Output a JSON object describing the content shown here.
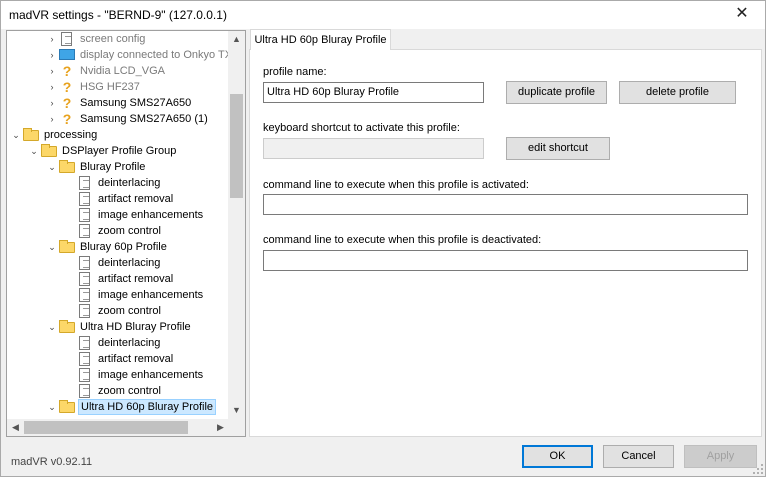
{
  "window": {
    "title": "madVR settings - \"BERND-9\" (127.0.0.1)",
    "close_glyph": "✕"
  },
  "tree": {
    "items": [
      {
        "label": "screen config",
        "icon": "doc-icon",
        "dim": true
      },
      {
        "label": "display connected to Onkyo TX-N",
        "icon": "monitor-icon",
        "dim": true
      },
      {
        "label": "Nvidia LCD_VGA",
        "icon": "question-icon",
        "dim": true
      },
      {
        "label": "HSG HF237",
        "icon": "question-icon",
        "dim": true
      },
      {
        "label": "Samsung SMS27A650",
        "icon": "question-icon",
        "dim": false
      },
      {
        "label": "Samsung SMS27A650 (1)",
        "icon": "question-icon",
        "dim": false
      },
      {
        "label": "processing",
        "icon": "folder-icon",
        "dim": false
      },
      {
        "label": "DSPlayer Profile Group",
        "icon": "folder-icon",
        "dim": false
      },
      {
        "label": "Bluray Profile",
        "icon": "folder-icon",
        "dim": false
      },
      {
        "label": "deinterlacing",
        "icon": "doc-icon",
        "dim": false
      },
      {
        "label": "artifact removal",
        "icon": "doc-icon",
        "dim": false
      },
      {
        "label": "image enhancements",
        "icon": "doc-icon",
        "dim": false
      },
      {
        "label": "zoom control",
        "icon": "doc-icon",
        "dim": false
      },
      {
        "label": "Bluray 60p Profile",
        "icon": "folder-icon",
        "dim": false
      },
      {
        "label": "deinterlacing",
        "icon": "doc-icon",
        "dim": false
      },
      {
        "label": "artifact removal",
        "icon": "doc-icon",
        "dim": false
      },
      {
        "label": "image enhancements",
        "icon": "doc-icon",
        "dim": false
      },
      {
        "label": "zoom control",
        "icon": "doc-icon",
        "dim": false
      },
      {
        "label": "Ultra HD Bluray Profile",
        "icon": "folder-icon",
        "dim": false
      },
      {
        "label": "deinterlacing",
        "icon": "doc-icon",
        "dim": false
      },
      {
        "label": "artifact removal",
        "icon": "doc-icon",
        "dim": false
      },
      {
        "label": "image enhancements",
        "icon": "doc-icon",
        "dim": false
      },
      {
        "label": "zoom control",
        "icon": "doc-icon",
        "dim": false
      },
      {
        "label": "Ultra HD 60p Bluray Profile",
        "icon": "folder-open-icon",
        "dim": false,
        "selected": true
      }
    ]
  },
  "tab": {
    "label": "Ultra HD 60p Bluray Profile"
  },
  "form": {
    "profile_name_label": "profile name:",
    "profile_name_value": "Ultra HD 60p Bluray Profile",
    "duplicate_label": "duplicate profile",
    "delete_label": "delete profile",
    "shortcut_label": "keyboard shortcut to activate this profile:",
    "shortcut_value": "",
    "edit_shortcut_label": "edit shortcut",
    "cmd_activated_label": "command line to execute when this profile is activated:",
    "cmd_activated_value": "",
    "cmd_deactivated_label": "command line to execute when this profile is deactivated:",
    "cmd_deactivated_value": ""
  },
  "footer": {
    "version": "madVR v0.92.11",
    "ok_label": "OK",
    "cancel_label": "Cancel",
    "apply_label": "Apply"
  }
}
